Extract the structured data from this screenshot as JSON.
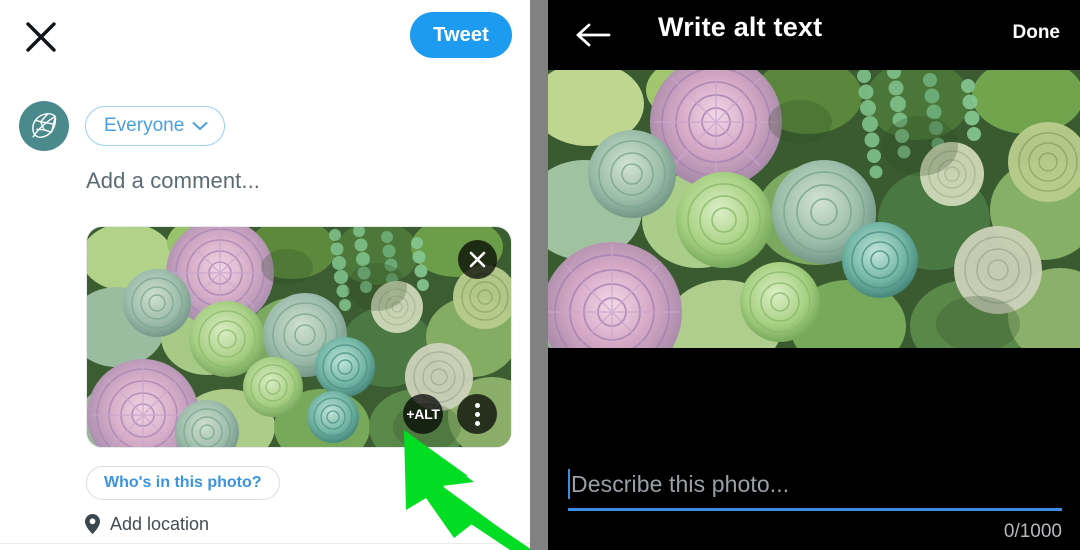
{
  "compose": {
    "close_icon": "close-x-icon",
    "tweet_button_label": "Tweet",
    "avatar_icon": "leaf-logo-avatar",
    "audience_label": "Everyone",
    "audience_chevron_icon": "chevron-down-icon",
    "comment_placeholder": "Add a comment...",
    "photo": {
      "alt_description": "Overhead photo of a dense succulent garden with green rosettes, string-of-pearls style trailing plants and two large pink-purple echeveria rosettes",
      "remove_icon": "close-x-icon",
      "alt_badge_label": "+ALT",
      "more_options_icon": "vertical-dots-icon"
    },
    "tag_people_label": "Who's in this photo?",
    "location_icon": "location-pin-icon",
    "location_label": "Add location",
    "pointer_icon": "green-cursor-arrow"
  },
  "alt_text_screen": {
    "back_icon": "back-arrow-icon",
    "title": "Write alt text",
    "done_label": "Done",
    "photo": {
      "alt_description": "Zoomed view of the same succulent garden photo"
    },
    "input_placeholder": "Describe this photo...",
    "input_value": "",
    "char_counter": "0/1000"
  },
  "colors": {
    "twitter_blue": "#1d9bf0",
    "avatar_teal": "#4a8a8c",
    "divider_gray": "#818181",
    "pointer_green": "#00dd22",
    "dark_bg": "#000000",
    "placeholder_gray": "#5b6b73"
  }
}
